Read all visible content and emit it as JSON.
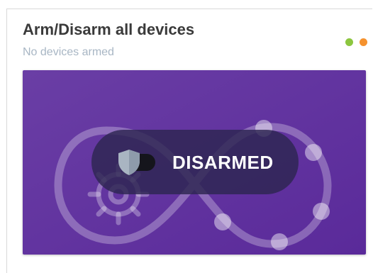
{
  "card": {
    "title": "Arm/Disarm all devices",
    "subtitle": "No devices armed"
  },
  "status_dots": [
    {
      "name": "green",
      "color": "#8cc63f"
    },
    {
      "name": "orange",
      "color": "#f5922e"
    }
  ],
  "panel": {
    "background_top": "#6a3ea5",
    "background_bottom": "#5a2a9a",
    "graphic": "infinity-gear-illustration"
  },
  "toggle": {
    "state_label": "DISARMED",
    "icon": "shield-icon",
    "on": false
  }
}
